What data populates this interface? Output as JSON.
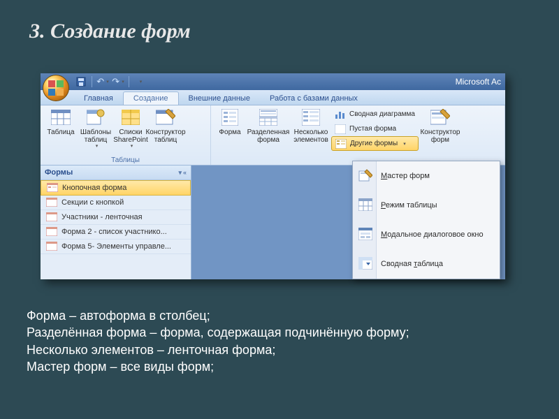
{
  "slide": {
    "title": "3. Создание форм",
    "bullets": [
      "Форма – автоформа в столбец;",
      "Разделённая форма – форма, содержащая подчинённую форму;",
      "Несколько элементов – ленточная форма;",
      "Мастер форм – все виды форм;"
    ]
  },
  "titlebar": {
    "app": "Microsoft Ac"
  },
  "tabs": {
    "items": [
      "Главная",
      "Создание",
      "Внешние данные",
      "Работа с базами данных"
    ],
    "active_index": 1
  },
  "ribbon": {
    "group_tables": {
      "label": "Таблицы",
      "btn_table": "Таблица",
      "btn_templates": "Шаблоны таблиц",
      "btn_sharepoint": "Списки SharePoint",
      "btn_designer": "Конструктор таблиц"
    },
    "group_forms": {
      "btn_form": "Форма",
      "btn_split": "Разделенная форма",
      "btn_multi": "Несколько элементов",
      "btn_pivotchart": "Сводная диаграмма",
      "btn_blank": "Пустая форма",
      "btn_more": "Другие формы",
      "btn_designer": "Конструктор форм"
    }
  },
  "navpane": {
    "header": "Формы",
    "items": [
      "Кнопочная форма",
      "Секции с кнопкой",
      "Участники - ленточная",
      "Форма 2 - список участнико...",
      "Форма 5- Элементы управле..."
    ],
    "selected_index": 0
  },
  "popup": {
    "items": [
      {
        "label": "Мастер форм",
        "u": "М"
      },
      {
        "label": "Режим таблицы",
        "u": "Р"
      },
      {
        "label": "Модальное диалоговое окно",
        "u": "М"
      },
      {
        "label": "Сводная таблица",
        "u": "т"
      }
    ]
  }
}
